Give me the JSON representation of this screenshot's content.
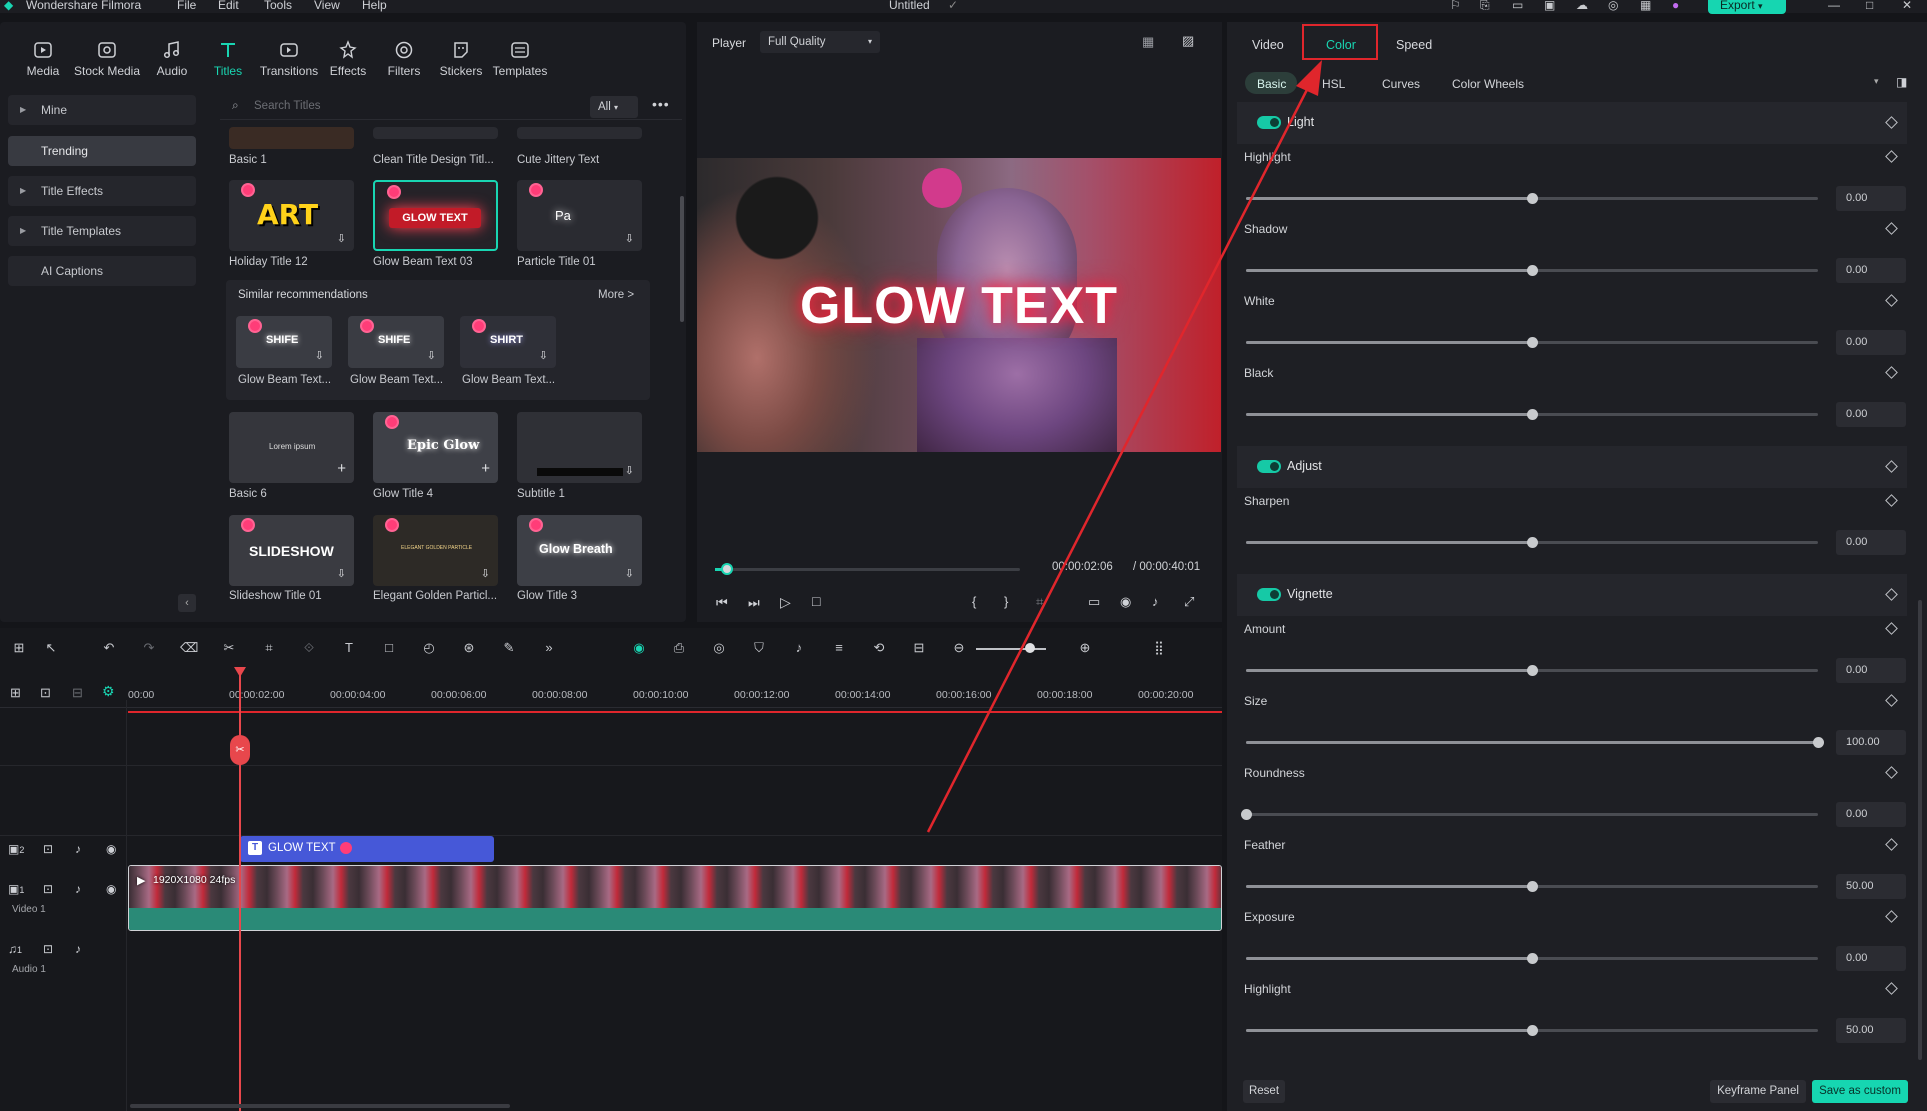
{
  "app": {
    "name": "Wondershare Filmora",
    "doc_title": "Untitled",
    "menu": [
      "File",
      "Edit",
      "Tools",
      "View",
      "Help"
    ],
    "export_label": "Export"
  },
  "toolbar": {
    "items": [
      {
        "label": "Media",
        "icon": "media-icon"
      },
      {
        "label": "Stock Media",
        "icon": "stock-media-icon"
      },
      {
        "label": "Audio",
        "icon": "audio-icon"
      },
      {
        "label": "Titles",
        "icon": "titles-icon"
      },
      {
        "label": "Transitions",
        "icon": "transitions-icon"
      },
      {
        "label": "Effects",
        "icon": "effects-icon"
      },
      {
        "label": "Filters",
        "icon": "filters-icon"
      },
      {
        "label": "Stickers",
        "icon": "stickers-icon"
      },
      {
        "label": "Templates",
        "icon": "templates-icon"
      }
    ],
    "active": "Titles"
  },
  "library": {
    "categories": [
      "Mine",
      "Trending",
      "Title Effects",
      "Title Templates",
      "AI Captions"
    ],
    "selected_category": "Trending",
    "search_placeholder": "Search Titles",
    "filter": "All",
    "row0": [
      "Basic 1",
      "Clean Title Design Titl...",
      "Cute Jittery Text"
    ],
    "row1": [
      {
        "label": "Holiday Title 12",
        "art": "ART"
      },
      {
        "label": "Glow Beam Text 03",
        "art": "GLOW TEXT"
      },
      {
        "label": "Particle Title 01",
        "art": "Pa"
      }
    ],
    "similar": {
      "heading": "Similar recommendations",
      "more": "More >",
      "items": [
        {
          "label": "Glow Beam Text...",
          "art": "SHIFE"
        },
        {
          "label": "Glow Beam Text...",
          "art": "SHIFE"
        },
        {
          "label": "Glow Beam Text...",
          "art": "SHIRT"
        }
      ]
    },
    "row3": [
      {
        "label": "Basic 6",
        "art": "Lorem ipsum"
      },
      {
        "label": "Glow Title 4",
        "art": "Epic Glow"
      },
      {
        "label": "Subtitle 1",
        "art": ""
      }
    ],
    "row4": [
      {
        "label": "Slideshow Title 01",
        "art": "SLIDESHOW"
      },
      {
        "label": "Elegant Golden Particl...",
        "art": "ELEGANT GOLDEN PARTICLE"
      },
      {
        "label": "Glow Title 3",
        "art": "Glow Breath"
      }
    ]
  },
  "player": {
    "label": "Player",
    "quality": "Full Quality",
    "overlay_text": "GLOW TEXT",
    "current_time": "00:00:02:06",
    "total_time": "/ 00:00:40:01",
    "progress": 0.04
  },
  "inspector": {
    "tabs": [
      "Video",
      "Color",
      "Speed"
    ],
    "active_tab": "Color",
    "subtabs": [
      "Basic",
      "HSL",
      "Curves",
      "Color Wheels"
    ],
    "active_subtab": "Basic",
    "sections": [
      {
        "title": "Light",
        "params": [
          {
            "name": "Highlight",
            "value": "0.00",
            "pos": 0.5
          },
          {
            "name": "Shadow",
            "value": "0.00",
            "pos": 0.5
          },
          {
            "name": "White",
            "value": "0.00",
            "pos": 0.5
          },
          {
            "name": "Black",
            "value": "0.00",
            "pos": 0.5
          }
        ]
      },
      {
        "title": "Adjust",
        "params": [
          {
            "name": "Sharpen",
            "value": "0.00",
            "pos": 0.5
          }
        ]
      },
      {
        "title": "Vignette",
        "params": [
          {
            "name": "Amount",
            "value": "0.00",
            "pos": 0.5
          },
          {
            "name": "Size",
            "value": "100.00",
            "pos": 1.0
          },
          {
            "name": "Roundness",
            "value": "0.00",
            "pos": 0.0
          },
          {
            "name": "Feather",
            "value": "50.00",
            "pos": 0.5
          },
          {
            "name": "Exposure",
            "value": "0.00",
            "pos": 0.5
          },
          {
            "name": "Highlight",
            "value": "50.00",
            "pos": 0.5
          }
        ]
      }
    ],
    "footer": {
      "reset": "Reset",
      "keyframe": "Keyframe Panel",
      "save": "Save as custom"
    }
  },
  "timeline": {
    "ruler": [
      "00:00",
      "00:00:02:00",
      "00:00:04:00",
      "00:00:06:00",
      "00:00:08:00",
      "00:00:10:00",
      "00:00:12:00",
      "00:00:14:00",
      "00:00:16:00",
      "00:00:18:00",
      "00:00:20:00"
    ],
    "title_clip": "GLOW TEXT",
    "video_clip": "1920X1080 24fps",
    "tracks": [
      {
        "num": "2",
        "label": ""
      },
      {
        "num": "1",
        "label": "Video 1"
      },
      {
        "num": "1",
        "label": "Audio 1"
      }
    ]
  },
  "colors": {
    "accent": "#16d6b1",
    "highlight_box": "#e0262c",
    "arrow": "#e0262c",
    "clip_title": "#4658d8",
    "clip_video": "#2a8a77"
  }
}
